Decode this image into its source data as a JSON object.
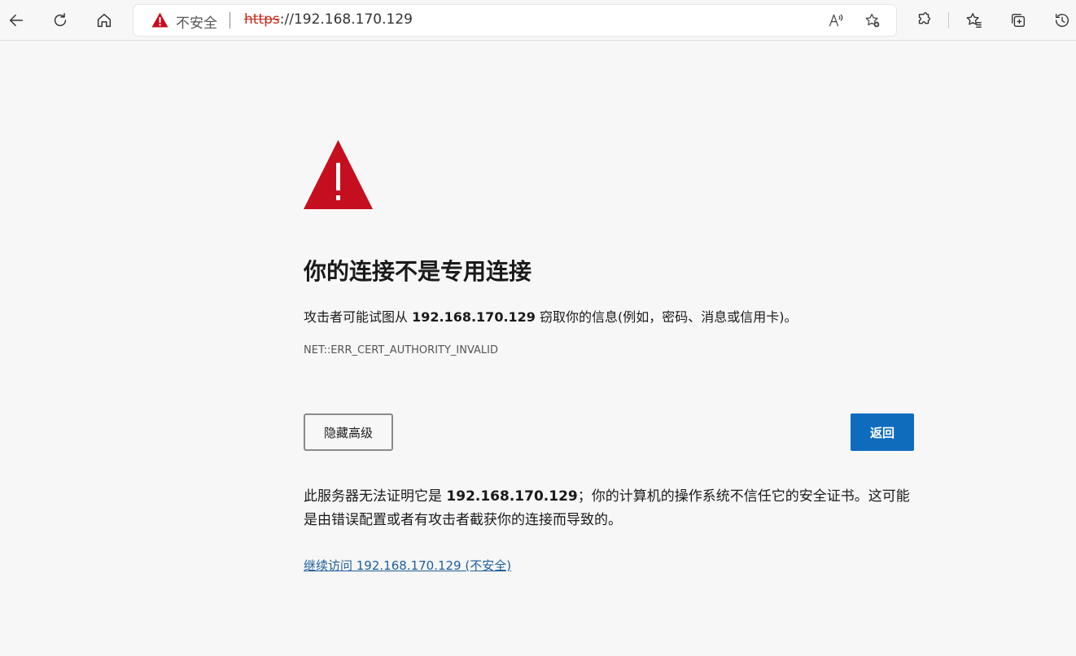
{
  "browser": {
    "address_bar": {
      "security_label": "不安全",
      "url_protocol": "https",
      "url_rest": "://192.168.170.129"
    },
    "icons": {
      "back": "back-arrow-icon",
      "refresh": "refresh-icon",
      "home": "home-icon",
      "read_aloud": "read-aloud-icon",
      "add_favorite": "add-favorite-icon",
      "extensions": "extensions-icon",
      "favorites": "favorites-icon",
      "collections": "collections-icon",
      "history": "history-icon"
    }
  },
  "page": {
    "heading": "你的连接不是专用连接",
    "description_prefix": "攻击者可能试图从 ",
    "host": "192.168.170.129",
    "description_suffix": " 窃取你的信息(例如，密码、消息或信用卡)。",
    "error_code": "NET::ERR_CERT_AUTHORITY_INVALID",
    "hide_advanced_label": "隐藏高级",
    "back_label": "返回",
    "detail_prefix": "此服务器无法证明它是 ",
    "detail_suffix": "；你的计算机的操作系统不信任它的安全证书。这可能是由错误配置或者有攻击者截获你的连接而导致的。",
    "proceed_link": "继续访问 192.168.170.129 (不安全)"
  },
  "colors": {
    "warning_red": "#c50f1f",
    "primary_blue": "#0f6cbd",
    "link_blue": "#1f5e9b",
    "background": "#f7f7f7"
  }
}
